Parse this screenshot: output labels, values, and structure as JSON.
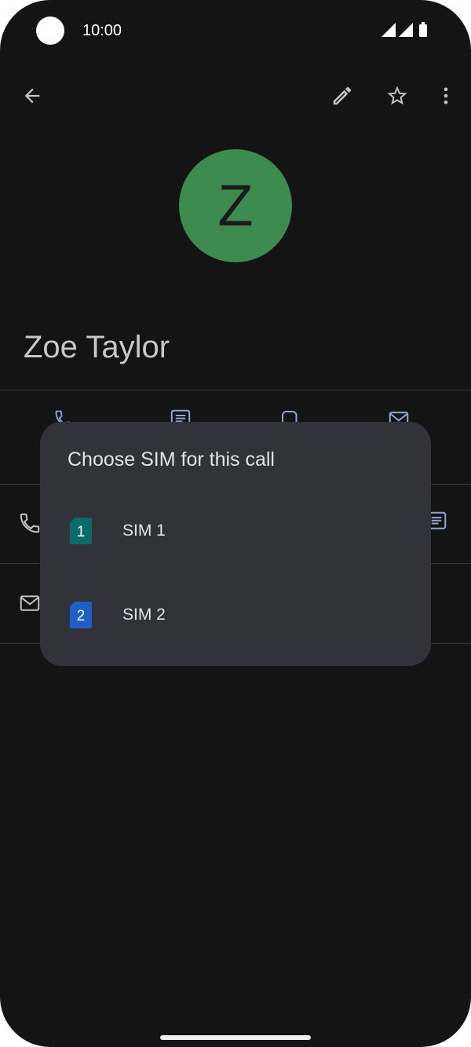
{
  "status_bar": {
    "time": "10:00"
  },
  "contact": {
    "avatar_letter": "Z",
    "name": "Zoe Taylor"
  },
  "dialog": {
    "title": "Choose SIM for this call",
    "options": [
      {
        "label": "SIM 1",
        "badge": "1",
        "color": "#0a6b6b"
      },
      {
        "label": "SIM 2",
        "badge": "2",
        "color": "#1f5fc7"
      }
    ]
  },
  "colors": {
    "background": "#141414",
    "avatar": "#3e8b4f",
    "dialog": "#31323a",
    "accent": "#8fa7d6"
  },
  "icons": [
    "back-arrow-icon",
    "edit-pencil-icon",
    "star-outline-icon",
    "more-vert-icon",
    "phone-icon",
    "message-icon",
    "video-icon",
    "email-icon"
  ]
}
